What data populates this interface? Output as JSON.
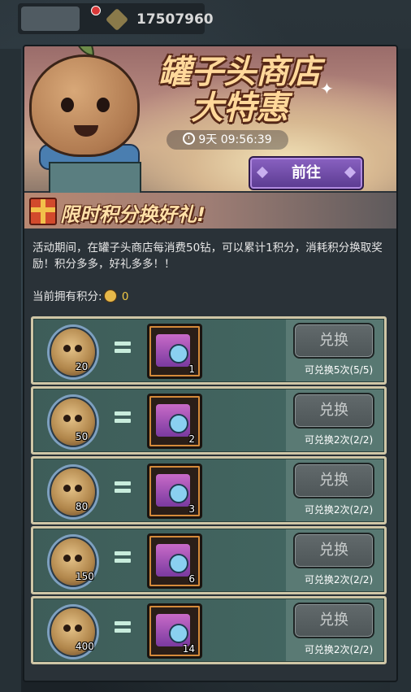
{
  "top_bar": {
    "currency_amount": "17507960"
  },
  "banner": {
    "title_line1": "罐子头商店",
    "title_line2": "大特惠",
    "timer": "9天 09:56:39",
    "goto_label": "前往"
  },
  "section": {
    "title": "限时积分换好礼!",
    "description": "活动期间，在罐子头商店每消费50钻，可以累计1积分，消耗积分换取奖励！积分多多，好礼多多！！",
    "points_label": "当前拥有积分:",
    "points_value": "0"
  },
  "rows": [
    {
      "cost": "20",
      "qty": "1",
      "button": "兑换",
      "remain": "可兑换5次(5/5)"
    },
    {
      "cost": "50",
      "qty": "2",
      "button": "兑换",
      "remain": "可兑换2次(2/2)"
    },
    {
      "cost": "80",
      "qty": "3",
      "button": "兑换",
      "remain": "可兑换2次(2/2)"
    },
    {
      "cost": "150",
      "qty": "6",
      "button": "兑换",
      "remain": "可兑换2次(2/2)"
    },
    {
      "cost": "400",
      "qty": "14",
      "button": "兑换",
      "remain": "可兑换2次(2/2)"
    }
  ],
  "icons": {
    "mascot": "jar-head-mascot",
    "gift": "gift-icon",
    "point": "jar-coin-icon",
    "reward": "purple-chest-icon",
    "timer": "clock-icon"
  },
  "colors": {
    "title_text": "#ffd89a",
    "goto_button": "#6e4aa8",
    "row_bg": "#426560",
    "points_value": "#f0c844"
  }
}
